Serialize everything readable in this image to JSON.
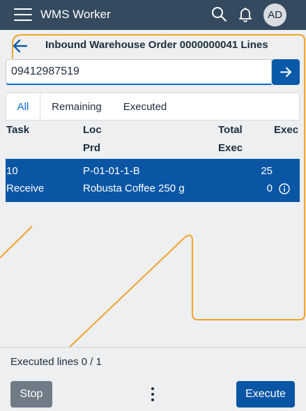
{
  "shellbar": {
    "title": "WMS Worker",
    "avatar_initials": "AD",
    "icons": [
      "menu-icon",
      "search-icon",
      "bell-icon"
    ]
  },
  "page": {
    "title": "Inbound Warehouse Order 0000000041 Lines"
  },
  "scan": {
    "value": "09412987519",
    "button_icon": "arrow-right-icon"
  },
  "tabs": [
    {
      "label": "All",
      "selected": true
    },
    {
      "label": "Remaining",
      "selected": false
    },
    {
      "label": "Executed",
      "selected": false
    }
  ],
  "table": {
    "headers": {
      "task": "Task",
      "loc": "Loc",
      "prd": "Prd",
      "total": "Total",
      "exec_top": "Exec",
      "exec": "Exec"
    },
    "rows": [
      {
        "task": "10",
        "action": "Receive",
        "loc": "P-01-01-1-B",
        "prd": "Robusta Coffee 250 g",
        "total": "25",
        "exec": "0",
        "selected": true
      }
    ]
  },
  "footer": {
    "executed_lines": "Executed lines 0 / 1",
    "stop_label": "Stop",
    "execute_label": "Execute"
  },
  "colors": {
    "shellbar": "#354a5f",
    "accent": "#0a6ed1",
    "selected_row": "#0a56a5",
    "stop_button": "#6f7b86",
    "decoration_line": "#f0a32b"
  }
}
